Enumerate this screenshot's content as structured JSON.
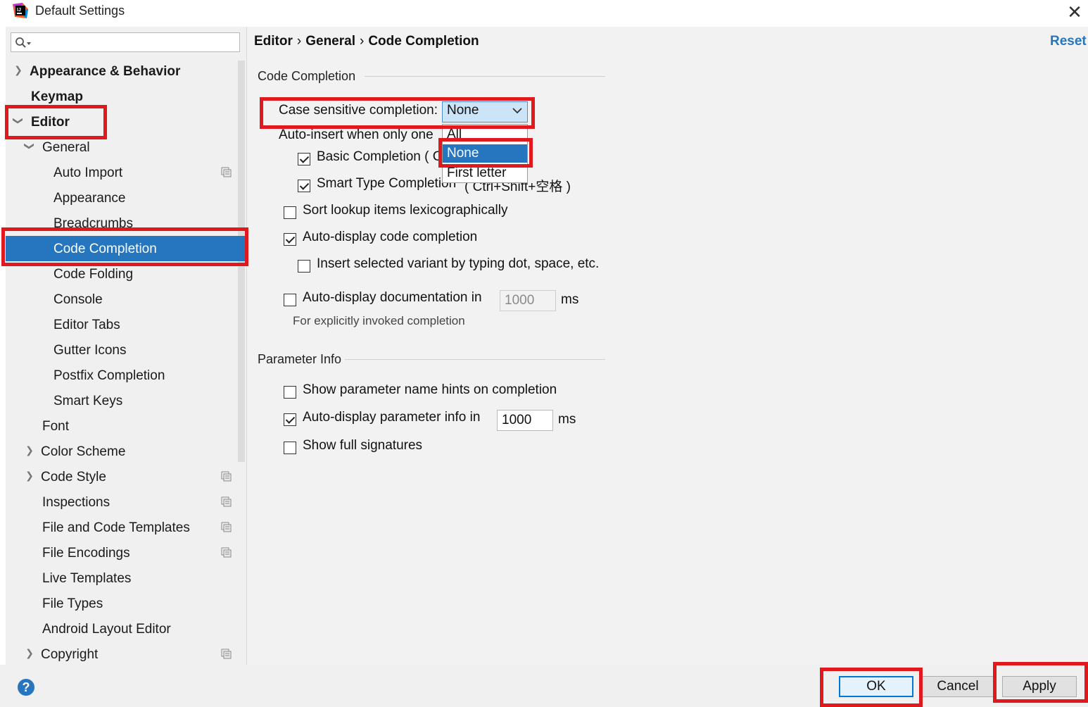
{
  "window": {
    "title": "Default Settings",
    "close_glyph": "✕"
  },
  "search": {
    "placeholder": ""
  },
  "sidebar": {
    "items": [
      {
        "label": "Appearance & Behavior"
      },
      {
        "label": "Keymap"
      },
      {
        "label": "Editor"
      },
      {
        "label": "General"
      },
      {
        "label": "Auto Import"
      },
      {
        "label": "Appearance"
      },
      {
        "label": "Breadcrumbs"
      },
      {
        "label": "Code Completion"
      },
      {
        "label": "Code Folding"
      },
      {
        "label": "Console"
      },
      {
        "label": "Editor Tabs"
      },
      {
        "label": "Gutter Icons"
      },
      {
        "label": "Postfix Completion"
      },
      {
        "label": "Smart Keys"
      },
      {
        "label": "Font"
      },
      {
        "label": "Color Scheme"
      },
      {
        "label": "Code Style"
      },
      {
        "label": "Inspections"
      },
      {
        "label": "File and Code Templates"
      },
      {
        "label": "File Encodings"
      },
      {
        "label": "Live Templates"
      },
      {
        "label": "File Types"
      },
      {
        "label": "Android Layout Editor"
      },
      {
        "label": "Copyright"
      }
    ]
  },
  "breadcrumb": {
    "part1": "Editor",
    "part2": "General",
    "part3": "Code Completion",
    "sep": "›"
  },
  "reset_label": "Reset",
  "code_completion": {
    "section_title": "Code Completion",
    "case_sensitive_label": "Case sensitive completion:",
    "case_sensitive_value": "None",
    "dropdown_options": [
      "All",
      "None",
      "First letter"
    ],
    "dropdown_selected": "None",
    "auto_insert_label": "Auto-insert when only one",
    "basic_completion_label": "Basic Completion ( C",
    "smart_type_label": "Smart Type Completion",
    "smart_type_tail": "( Ctrl+Shift+空格 )",
    "sort_lookup_label": "Sort lookup items lexicographically",
    "auto_display_completion_label": "Auto-display code completion",
    "insert_variant_label": "Insert selected variant by typing dot, space, etc.",
    "auto_display_doc_label": "Auto-display documentation in",
    "auto_display_doc_value": "1000",
    "ms_label": "ms",
    "doc_hint": "For explicitly invoked completion"
  },
  "checkbox_states": {
    "basic_completion": true,
    "smart_type": true,
    "sort_lookup": false,
    "auto_display_completion": true,
    "insert_variant": false,
    "auto_display_doc": false,
    "show_param_hints": false,
    "auto_display_param_info": true,
    "show_full_signatures": false
  },
  "parameter_info": {
    "section_title": "Parameter Info",
    "show_param_hints_label": "Show parameter name hints on completion",
    "auto_display_param_label": "Auto-display parameter info in",
    "auto_display_param_value": "1000",
    "ms_label": "ms",
    "show_full_signatures_label": "Show full signatures"
  },
  "buttons": {
    "ok": "OK",
    "cancel": "Cancel",
    "apply": "Apply",
    "help": "?"
  },
  "colors": {
    "accent": "#2675bf",
    "highlight_red": "#e0191e",
    "panel_bg": "#f2f2f2"
  },
  "icons": [
    "intellij-app-icon",
    "search-icon",
    "close-icon",
    "chevron-right-icon",
    "chevron-down-icon",
    "copy-project-icon",
    "help-icon"
  ]
}
